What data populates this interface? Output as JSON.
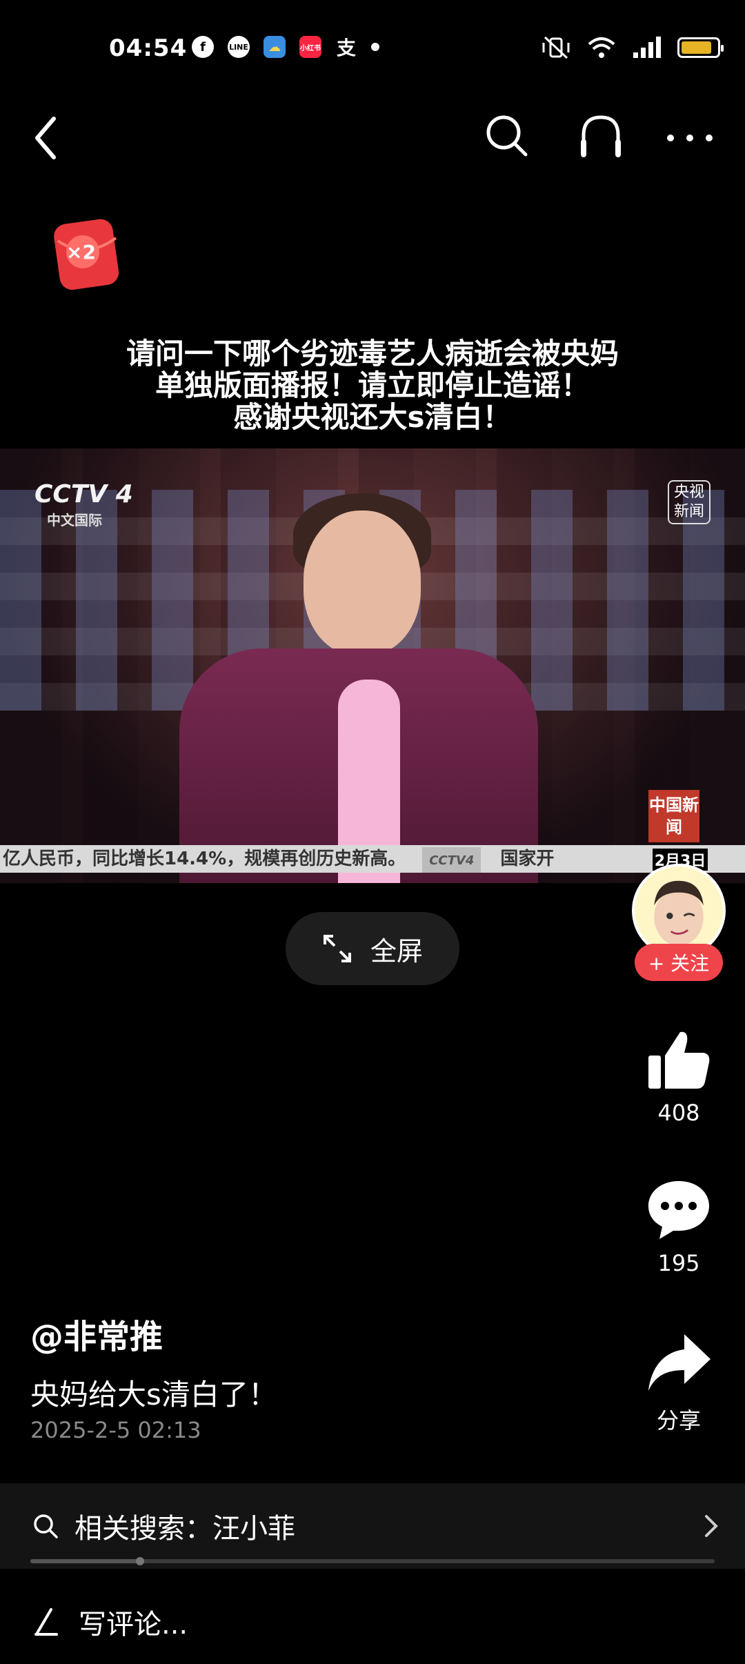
{
  "status_bar": {
    "time": "04:54",
    "app_icons": [
      "facebook-icon",
      "line-icon",
      "weather-icon",
      "xiaohongshu-icon",
      "alipay-icon"
    ],
    "xiaohongshu_label": "小红书",
    "alipay_label": "支",
    "battery_level": 0.85
  },
  "video": {
    "caption_lines": [
      "请问一下哪个劣迹毒艺人病逝会被央妈",
      "单独版面播报！请立即停止造谣！",
      "感谢央视还大s清白！"
    ],
    "channel_logo": "CCTV 4",
    "channel_sub": "中文国际",
    "news_badge": "央视新闻",
    "china_news_logo": "中国新闻",
    "ticker_text": "亿人民币，同比增长14.4%，规模再创历史新高。",
    "ticker_tag": "CCTV4",
    "ticker_tail": "国家开",
    "date": "2月3日"
  },
  "fullscreen_label": "全屏",
  "rail": {
    "follow_label": "+ 关注",
    "likes": "408",
    "comments": "195",
    "share_label": "分享"
  },
  "post": {
    "author": "@非常推",
    "description": "央妈给大s清白了！",
    "timestamp": "2025-2-5 02:13"
  },
  "related_search": {
    "label": "相关搜索：汪小菲"
  },
  "progress_fraction": 0.16,
  "comment_placeholder": "写评论...",
  "colors": {
    "follow": "#f0444b",
    "battery": "#e5b323",
    "red_packet": "#e8383d"
  },
  "red_packet_label": "×2"
}
